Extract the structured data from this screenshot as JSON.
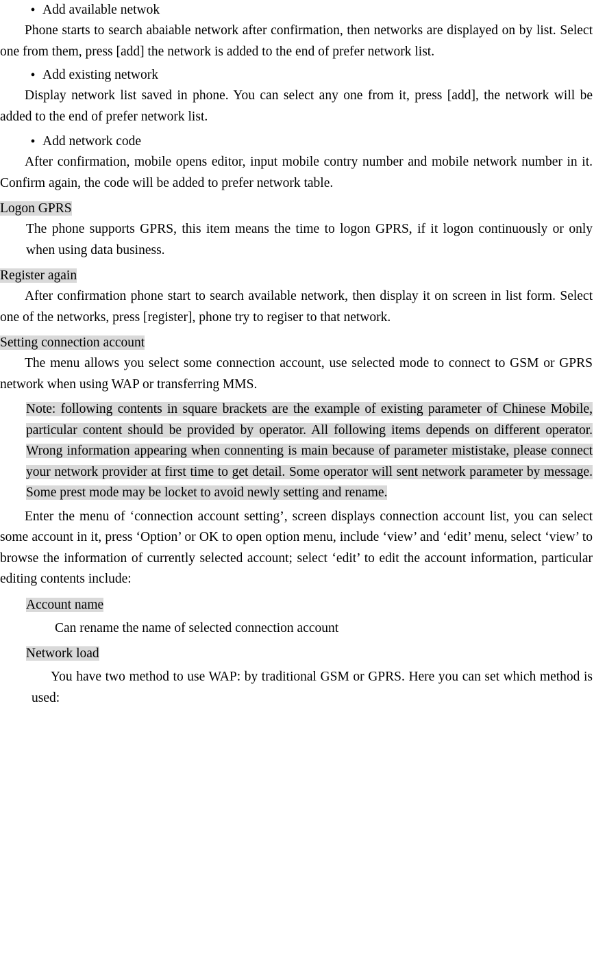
{
  "document": {
    "sections": [
      {
        "type": "bullet",
        "label": "Add available netwok"
      },
      {
        "type": "paragraph",
        "style": "indent",
        "text": "Phone starts to search abaiable network after confirmation, then networks are displayed on by list. Select one from them, press [add] the network is added to the end of prefer network list."
      },
      {
        "type": "bullet",
        "label": "Add existing network"
      },
      {
        "type": "paragraph",
        "style": "indent",
        "text": "Display network list saved in phone. You can select any one from it, press [add], the network will be added to the end of prefer network list."
      },
      {
        "type": "bullet",
        "label": "Add network code"
      },
      {
        "type": "paragraph",
        "style": "indent",
        "text": "After confirmation, mobile opens editor, input mobile contry number and mobile network number in it. Confirm again, the code will be added to prefer network table."
      },
      {
        "type": "heading",
        "text": "Logon GPRS"
      },
      {
        "type": "paragraph",
        "style": "indent-l",
        "text": "The phone supports GPRS, this item means the time to logon GPRS, if it logon continuously or only when using data business."
      },
      {
        "type": "heading",
        "text": "Register again  "
      },
      {
        "type": "paragraph",
        "style": "indent",
        "text": "After confirmation phone start to search available network, then display it on screen in list form. Select one of the networks, press [register], phone try to regiser to that network."
      },
      {
        "type": "heading",
        "text": "Setting connection account  "
      },
      {
        "type": "paragraph",
        "style": "indent",
        "text": "The menu allows you select some connection account, use selected mode to connect to GSM or GPRS network when using WAP or transferring MMS."
      },
      {
        "type": "note",
        "text": "Note: following contents in square brackets are the example of existing parameter of Chinese Mobile, particular content should be provided by operator. All following items depends on different operator. Wrong information appearing when connenting is main because of parameter mististake, please connect your network provider at first time to get detail. Some operator will sent network parameter by message. Some prest mode may be locket to avoid newly setting and rename.  "
      },
      {
        "type": "paragraph",
        "style": "indent",
        "text": "Enter the menu of ‘connection account setting’, screen displays connection account list, you can select some account in it, press ‘Option’ or OK to open option menu, include ‘view’ and ‘edit’ menu, select ‘view’ to browse the information of currently selected account; select ‘edit’ to edit the account information, particular editing contents include:"
      },
      {
        "type": "heading-indent",
        "text": "Account name"
      },
      {
        "type": "paragraph",
        "style": "hang-deep",
        "text": "Can rename the name of selected connection account"
      },
      {
        "type": "heading-indent",
        "text": "Network load"
      },
      {
        "type": "paragraph",
        "style": "hang",
        "text": "You have two method to use WAP: by traditional GSM or GPRS. Here you can set which method is used:"
      }
    ],
    "bullet_glyph": "•"
  }
}
